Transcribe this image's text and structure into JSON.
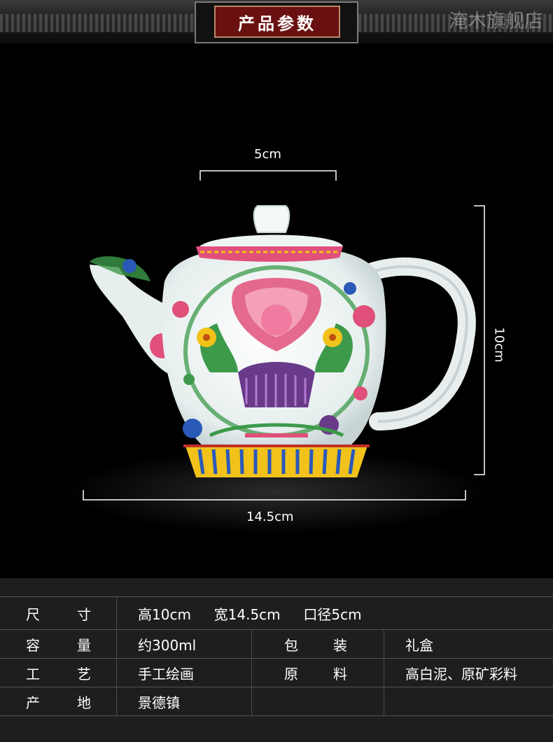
{
  "header": {
    "title": "产品参数",
    "watermark": "淹木旗舰店"
  },
  "dimensions": {
    "mouth": "5cm",
    "height": "10cm",
    "width": "14.5cm"
  },
  "specs": {
    "size": {
      "label_a": "尺",
      "label_b": "寸",
      "height": "高10cm",
      "width": "宽14.5cm",
      "mouth": "口径5cm"
    },
    "capacity": {
      "label_a": "容",
      "label_b": "量",
      "value": "约300ml"
    },
    "packaging": {
      "label_a": "包",
      "label_b": "装",
      "value": "礼盒"
    },
    "craft": {
      "label_a": "工",
      "label_b": "艺",
      "value": "手工绘画"
    },
    "material": {
      "label_a": "原",
      "label_b": "料",
      "value": "高白泥、原矿彩料"
    },
    "origin": {
      "label_a": "产",
      "label_b": "地",
      "value": "景德镇"
    }
  },
  "colors": {
    "banner_red": "#6b1010",
    "glaze_white": "#eef4f4",
    "enamel_pink": "#e0507a",
    "enamel_green": "#3c9a4a",
    "enamel_yellow": "#f2c21a",
    "enamel_blue": "#2a5ab8",
    "enamel_purple": "#6a3a8a"
  }
}
